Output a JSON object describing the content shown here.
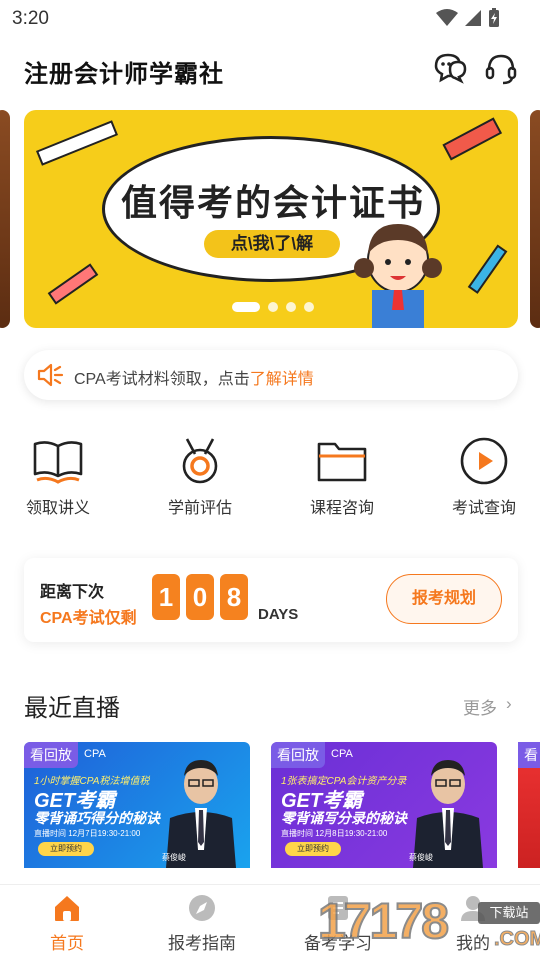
{
  "status_bar": {
    "time": "3:20"
  },
  "header": {
    "title": "注册会计师学霸社"
  },
  "banner": {
    "headline": "值得考的会计证书",
    "cta": "点\\我\\了\\解"
  },
  "notice": {
    "text": "CPA考试材料领取，点击",
    "link": "了解详情"
  },
  "quick_menu": [
    {
      "label": "领取讲义"
    },
    {
      "label": "学前评估"
    },
    {
      "label": "课程咨询"
    },
    {
      "label": "考试查询"
    }
  ],
  "countdown": {
    "line1": "距离下次",
    "line2": "CPA考试仅剩",
    "digits": [
      "1",
      "0",
      "8"
    ],
    "unit": "DAYS",
    "plan_button": "报考规划"
  },
  "live": {
    "title": "最近直播",
    "more": "更多",
    "cards": [
      {
        "badge": "看回放",
        "tag": "CPA",
        "subtitle": "1小时掌握CPA税法增值税",
        "get": "GET考霸",
        "slogan": "零背诵巧得分的秘诀",
        "time": "直播时间  12月7日19:30-21:00",
        "reserve": "立即预约",
        "teacher": "蔡俊峻"
      },
      {
        "badge": "看回放",
        "tag": "CPA",
        "subtitle": "1张表搞定CPA会计资产分录",
        "get": "GET考霸",
        "slogan": "零背诵写分录的秘诀",
        "time": "直播时间  12月8日19:30-21:00",
        "reserve": "立即预约",
        "teacher": "蔡俊峻"
      }
    ],
    "peek_badge": "看"
  },
  "bottom_nav": [
    {
      "label": "首页",
      "active": true
    },
    {
      "label": "报考指南",
      "active": false
    },
    {
      "label": "备考学习",
      "active": false
    },
    {
      "label": "我的",
      "active": false
    }
  ],
  "watermark": {
    "number": "17178",
    "tag": "下载站",
    "suffix": ".COM"
  },
  "colors": {
    "accent": "#f5781e",
    "banner_bg": "#f6cd1a",
    "live_blue": "#1f5fd8",
    "live_purple": "#6a2fd6"
  }
}
